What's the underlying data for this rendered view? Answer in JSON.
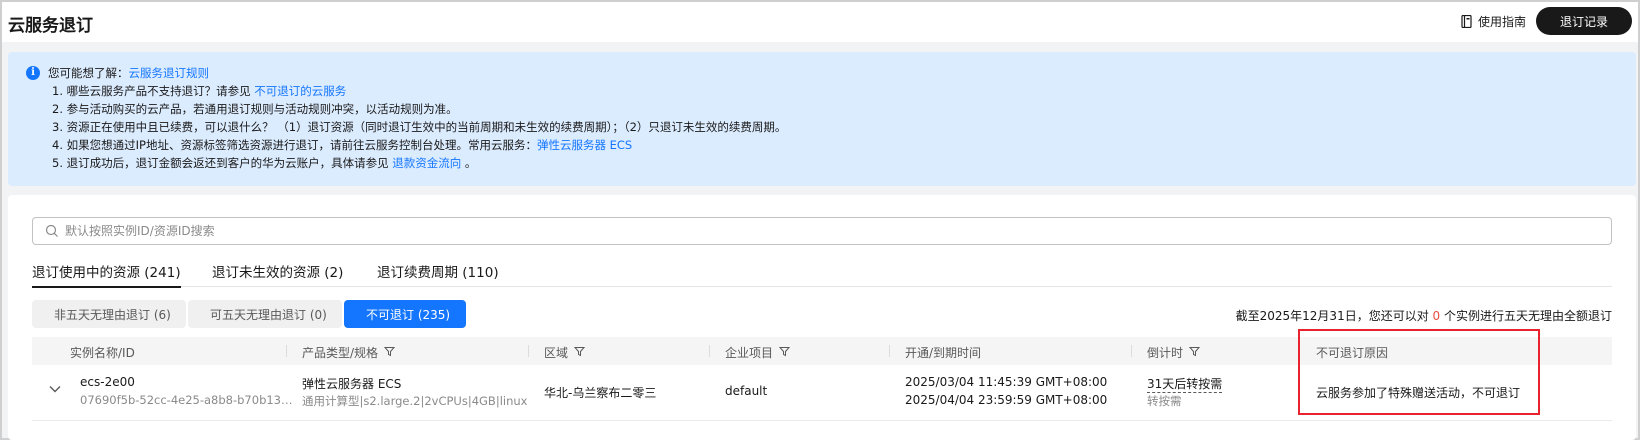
{
  "header": {
    "title": "云服务退订",
    "guide_label": "使用指南",
    "records_button": "退订记录"
  },
  "notice": {
    "intro": "您可能想了解：",
    "intro_link": "云服务退订规则",
    "line1_text": "1. 哪些云服务产品不支持退订？请参见 ",
    "line1_link": "不可退订的云服务",
    "line2_text": "2. 参与活动购买的云产品，若通用退订规则与活动规则冲突，以活动规则为准。",
    "line3_text": "3. 资源正在使用中且已续费，可以退什么？ （1）退订资源（同时退订生效中的当前周期和未生效的续费周期）；（2）只退订未生效的续费周期。",
    "line4_text": "4. 如果您想通过IP地址、资源标签筛选资源进行退订，请前往云服务控制台处理。常用云服务：",
    "line4_link": "弹性云服务器 ECS",
    "line5_text": "5. 退订成功后，退订金额会返还到客户的华为云账户，具体请参见 ",
    "line5_link": "退款资金流向",
    "line5_suffix": " 。"
  },
  "search": {
    "placeholder": "默认按照实例ID/资源ID搜索",
    "value": ""
  },
  "tabs": [
    {
      "label": "退订使用中的资源 (241)",
      "active": true
    },
    {
      "label": "退订未生效的资源 (2)",
      "active": false
    },
    {
      "label": "退订续费周期 (110)",
      "active": false
    }
  ],
  "subtabs": [
    {
      "label": "非五天无理由退订 (6)",
      "selected": false
    },
    {
      "label": "可五天无理由退订 (0)",
      "selected": false
    },
    {
      "label": "不可退订 (235)",
      "selected": true
    }
  ],
  "summary": {
    "prefix": "截至2025年12月31日，您还可以对 ",
    "count": "0",
    "suffix": " 个实例进行五天无理由全额退订"
  },
  "table": {
    "columns": [
      {
        "label": "实例名称/ID",
        "filter": false
      },
      {
        "label": "产品类型/规格",
        "filter": true
      },
      {
        "label": "区域",
        "filter": true
      },
      {
        "label": "企业项目",
        "filter": true
      },
      {
        "label": "开通/到期时间",
        "filter": false
      },
      {
        "label": "倒计时",
        "filter": true
      },
      {
        "label": "不可退订原因",
        "filter": false
      }
    ],
    "rows": [
      {
        "name": "ecs-2e00",
        "id": "07690f5b-52cc-4e25-a8b8-b70b13…",
        "product": "弹性云服务器 ECS",
        "spec": "通用计算型|s2.large.2|2vCPUs|4GB|linux",
        "region": "华北-乌兰察布二零三",
        "project": "default",
        "start_time": "2025/03/04 11:45:39 GMT+08:00",
        "end_time": "2025/04/04 23:59:59 GMT+08:00",
        "countdown": "31天后转按需",
        "countdown_sub": "转按需",
        "reason": "云服务参加了特殊赠送活动，不可退订"
      }
    ]
  },
  "colors": {
    "accent": "#1476ff",
    "notice_bg": "#dcecff",
    "highlight": "#e8232d",
    "warn": "#e84e40"
  }
}
